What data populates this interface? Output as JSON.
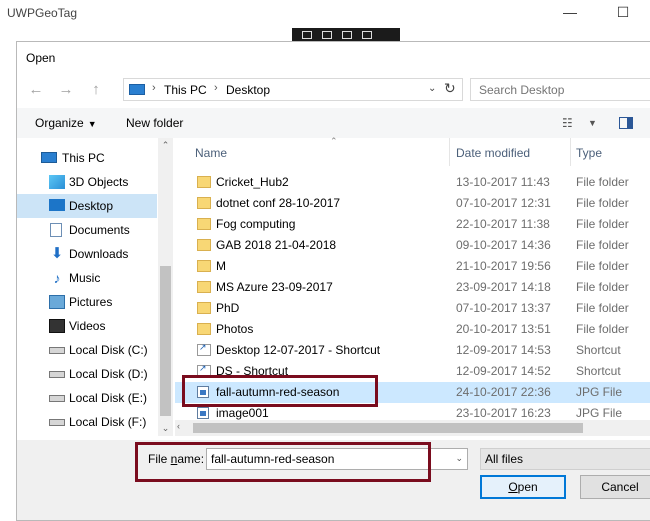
{
  "background_app": {
    "title": "UWPGeoTag",
    "minimize_glyph": "—",
    "maximize_glyph": "☐"
  },
  "dialog": {
    "title": "Open",
    "nav": {
      "back_glyph": "←",
      "forward_glyph": "→",
      "up_glyph": "↑"
    },
    "address": {
      "crumbs": [
        "This PC",
        "Desktop"
      ],
      "separator": "›",
      "dropdown_glyph": "⌄",
      "refresh_glyph": "↻"
    },
    "search": {
      "placeholder": "Search Desktop"
    },
    "toolbar": {
      "organize": "Organize",
      "organize_caret": "▼",
      "new_folder": "New folder",
      "view_glyph": "☷",
      "view_caret": "▼"
    },
    "nav_pane": {
      "scroll_up": "⌃",
      "scroll_down": "⌄",
      "items": [
        {
          "label": "This PC",
          "icon": "computer-icon"
        },
        {
          "label": "3D Objects",
          "icon": "cube-icon"
        },
        {
          "label": "Desktop",
          "icon": "desktop-icon",
          "selected": true
        },
        {
          "label": "Documents",
          "icon": "document-icon"
        },
        {
          "label": "Downloads",
          "icon": "download-icon"
        },
        {
          "label": "Music",
          "icon": "music-icon"
        },
        {
          "label": "Pictures",
          "icon": "pictures-icon"
        },
        {
          "label": "Videos",
          "icon": "video-icon"
        },
        {
          "label": "Local Disk (C:)",
          "icon": "drive-icon"
        },
        {
          "label": "Local Disk (D:)",
          "icon": "drive-icon"
        },
        {
          "label": "Local Disk (E:)",
          "icon": "drive-icon"
        },
        {
          "label": "Local Disk (F:)",
          "icon": "drive-icon"
        }
      ]
    },
    "file_list": {
      "sort_glyph": "⌃",
      "scroll_left": "‹",
      "scroll_right": "›",
      "columns": [
        "Name",
        "Date modified",
        "Type"
      ],
      "rows": [
        {
          "name": "Cricket_Hub2",
          "date": "13-10-2017 11:43",
          "type": "File folder",
          "kind": "folder"
        },
        {
          "name": "dotnet conf 28-10-2017",
          "date": "07-10-2017 12:31",
          "type": "File folder",
          "kind": "folder"
        },
        {
          "name": "Fog computing",
          "date": "22-10-2017 11:38",
          "type": "File folder",
          "kind": "folder"
        },
        {
          "name": "GAB 2018 21-04-2018",
          "date": "09-10-2017 14:36",
          "type": "File folder",
          "kind": "folder"
        },
        {
          "name": "M",
          "date": "21-10-2017 19:56",
          "type": "File folder",
          "kind": "folder"
        },
        {
          "name": "MS Azure 23-09-2017",
          "date": "23-09-2017 14:18",
          "type": "File folder",
          "kind": "folder"
        },
        {
          "name": "PhD",
          "date": "07-10-2017 13:37",
          "type": "File folder",
          "kind": "folder"
        },
        {
          "name": "Photos",
          "date": "20-10-2017 13:51",
          "type": "File folder",
          "kind": "folder"
        },
        {
          "name": "Desktop 12-07-2017 - Shortcut",
          "date": "12-09-2017 14:53",
          "type": "Shortcut",
          "kind": "shortcut"
        },
        {
          "name": "DS - Shortcut",
          "date": "12-09-2017 14:52",
          "type": "Shortcut",
          "kind": "shortcut"
        },
        {
          "name": "fall-autumn-red-season",
          "date": "24-10-2017 22:36",
          "type": "JPG File",
          "kind": "jpg",
          "selected": true
        },
        {
          "name": "image001",
          "date": "23-10-2017 16:23",
          "type": "JPG File",
          "kind": "jpg"
        }
      ]
    },
    "footer": {
      "file_name_label": "File name:",
      "file_name_value": "fall-autumn-red-season",
      "file_name_dropdown": "⌄",
      "file_type_filter": "All files",
      "open_button": "Open",
      "cancel_button": "Cancel"
    }
  },
  "colors": {
    "highlight_box": "#7a0c1e",
    "selection": "#cce8ff",
    "accent": "#0078d7"
  }
}
